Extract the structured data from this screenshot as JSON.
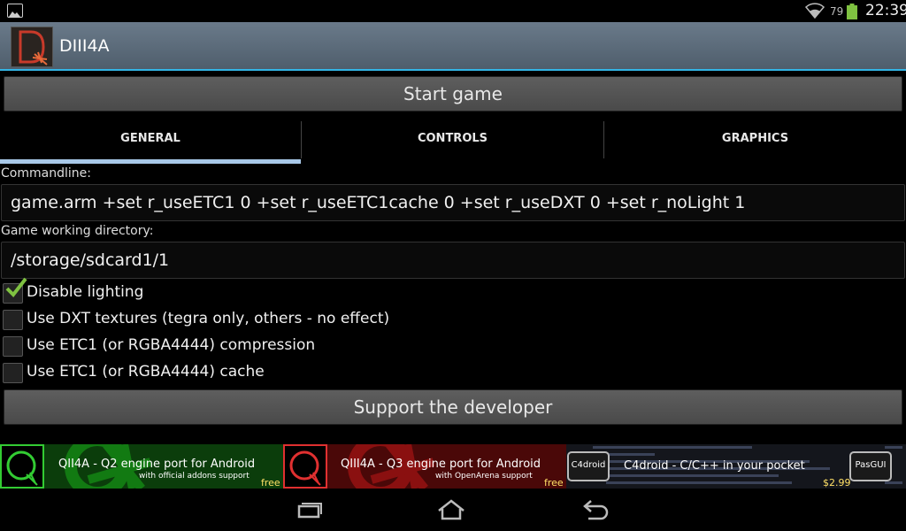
{
  "status_bar": {
    "notification_icon": "image-icon",
    "battery_percent": "79",
    "time": "22:39",
    "battery_color": "#7fc241"
  },
  "action_bar": {
    "title": "DIII4A",
    "icon": "app-d-logo"
  },
  "start_button": {
    "label": "Start game"
  },
  "tabs": [
    {
      "label": "GENERAL",
      "selected": true
    },
    {
      "label": "CONTROLS",
      "selected": false
    },
    {
      "label": "GRAPHICS",
      "selected": false
    }
  ],
  "general": {
    "commandline_label": "Commandline:",
    "commandline_value": "game.arm +set r_useETC1 0 +set r_useETC1cache 0 +set r_useDXT 0 +set r_noLight 1",
    "workdir_label": "Game working directory:",
    "workdir_value": "/storage/sdcard1/1",
    "checkboxes": [
      {
        "label": "Disable lighting",
        "checked": true
      },
      {
        "label": "Use DXT textures (tegra only, others - no effect)",
        "checked": false
      },
      {
        "label": "Use ETC1 (or RGBA4444) compression",
        "checked": false
      },
      {
        "label": "Use ETC1 (or RGBA4444) cache",
        "checked": false
      }
    ]
  },
  "support_button": {
    "label": "Support the developer"
  },
  "ads": [
    {
      "title": "QII4A - Q2 engine port for Android",
      "subtitle": "with official addons support",
      "tag": "free",
      "color": "#1a8a1a"
    },
    {
      "title": "QIII4A - Q3 engine port for Android",
      "subtitle": "with OpenArena support",
      "tag": "free",
      "color": "#a81414"
    },
    {
      "title": "C4droid - C/C++ in your pocket",
      "badge_left": "C4droid",
      "badge_right": "PasGUI",
      "price": "$2.99"
    }
  ],
  "nav_bar": {
    "recents_icon": "recent-apps-icon",
    "home_icon": "home-icon",
    "back_icon": "back-icon"
  }
}
